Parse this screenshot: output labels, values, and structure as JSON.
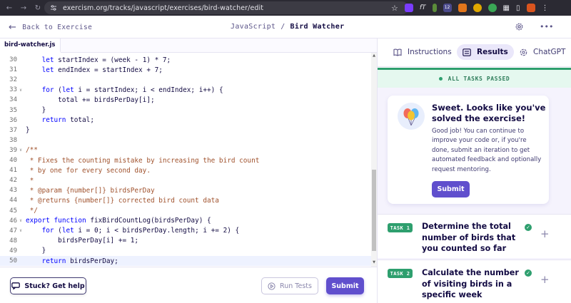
{
  "browser": {
    "url": "exercism.org/tracks/javascript/exercises/bird-watcher/edit",
    "extension_badge": "12"
  },
  "header": {
    "back_label": "Back to Exercise",
    "track": "JavaScript",
    "separator": "/",
    "exercise": "Bird Watcher"
  },
  "editor": {
    "file_tab": "bird-watcher.js",
    "lines": [
      {
        "n": "30",
        "fold": "",
        "text": "    let startIndex = (week - 1) * 7;"
      },
      {
        "n": "31",
        "fold": "",
        "text": "    let endIndex = startIndex + 7;"
      },
      {
        "n": "32",
        "fold": "",
        "text": ""
      },
      {
        "n": "33",
        "fold": "v",
        "text": "    for (let i = startIndex; i < endIndex; i++) {"
      },
      {
        "n": "34",
        "fold": "",
        "text": "        total += birdsPerDay[i];"
      },
      {
        "n": "35",
        "fold": "",
        "text": "    }"
      },
      {
        "n": "36",
        "fold": "",
        "text": "    return total;"
      },
      {
        "n": "37",
        "fold": "",
        "text": "}"
      },
      {
        "n": "38",
        "fold": "",
        "text": ""
      },
      {
        "n": "39",
        "fold": "v",
        "text": "/**"
      },
      {
        "n": "40",
        "fold": "",
        "text": " * Fixes the counting mistake by increasing the bird count"
      },
      {
        "n": "41",
        "fold": "",
        "text": " * by one for every second day."
      },
      {
        "n": "42",
        "fold": "",
        "text": " *"
      },
      {
        "n": "43",
        "fold": "",
        "text": " * @param {number[]} birdsPerDay"
      },
      {
        "n": "44",
        "fold": "",
        "text": " * @returns {number[]} corrected bird count data"
      },
      {
        "n": "45",
        "fold": "",
        "text": " */"
      },
      {
        "n": "46",
        "fold": "v",
        "text": "export function fixBirdCountLog(birdsPerDay) {"
      },
      {
        "n": "47",
        "fold": "v",
        "text": "    for (let i = 0; i < birdsPerDay.length; i += 2) {"
      },
      {
        "n": "48",
        "fold": "",
        "text": "        birdsPerDay[i] += 1;"
      },
      {
        "n": "49",
        "fold": "",
        "text": "    }"
      },
      {
        "n": "50",
        "fold": "",
        "text": "    return birdsPerDay;"
      }
    ],
    "active_line": "50"
  },
  "bottom": {
    "help_label": "Stuck? Get help",
    "run_label": "Run Tests",
    "submit_label": "Submit"
  },
  "panel": {
    "tabs": [
      {
        "label": "Instructions",
        "selected": false
      },
      {
        "label": "Results",
        "selected": true
      },
      {
        "label": "ChatGPT",
        "selected": false
      }
    ],
    "status": "ALL TASKS PASSED",
    "success_title": "Sweet. Looks like you've solved the exercise!",
    "success_body": "Good job! You can continue to improve your code or, if you're done, submit an iteration to get automated feedback and optionally request mentoring.",
    "success_button": "Submit",
    "tasks": [
      {
        "badge": "TASK 1",
        "title": "Determine the total number of birds that you counted so far"
      },
      {
        "badge": "TASK 2",
        "title": "Calculate the number of visiting birds in a specific week"
      }
    ]
  },
  "colors": {
    "accent": "#604fcd",
    "success": "#2e9f6e",
    "text_dark": "#130b43"
  }
}
